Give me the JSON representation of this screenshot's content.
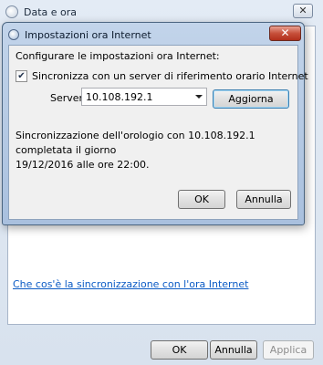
{
  "back_window": {
    "title": "Data e ora",
    "close_glyph": "✕",
    "link_text": "Che cos'è la sincronizzazione con l'ora Internet",
    "footer": {
      "ok": "OK",
      "cancel": "Annulla",
      "apply": "Applica"
    }
  },
  "dialog": {
    "title": "Impostazioni ora Internet",
    "close_glyph": "✕",
    "heading": "Configurare le impostazioni ora Internet:",
    "sync_checkbox": {
      "label": "Sincronizza con un server di riferimento orario Internet",
      "checked": true,
      "check_glyph": "✔"
    },
    "server": {
      "label": "Server:",
      "value": "10.108.192.1"
    },
    "update_button": "Aggiorna",
    "status_lines": [
      "Sincronizzazione dell'orologio con 10.108.192.1 completata il giorno",
      "19/12/2016 alle ore 22:00."
    ],
    "ok_button": "OK",
    "cancel_button": "Annulla"
  },
  "colors": {
    "link": "#0b5bc5",
    "close_button_red": "#c7503b",
    "dialog_frame": "#a9c0de"
  },
  "icons": {
    "window_icon": "clock-icon",
    "dialog_icon": "clock-icon",
    "close": "close-icon",
    "dropdown": "chevron-down-icon"
  }
}
